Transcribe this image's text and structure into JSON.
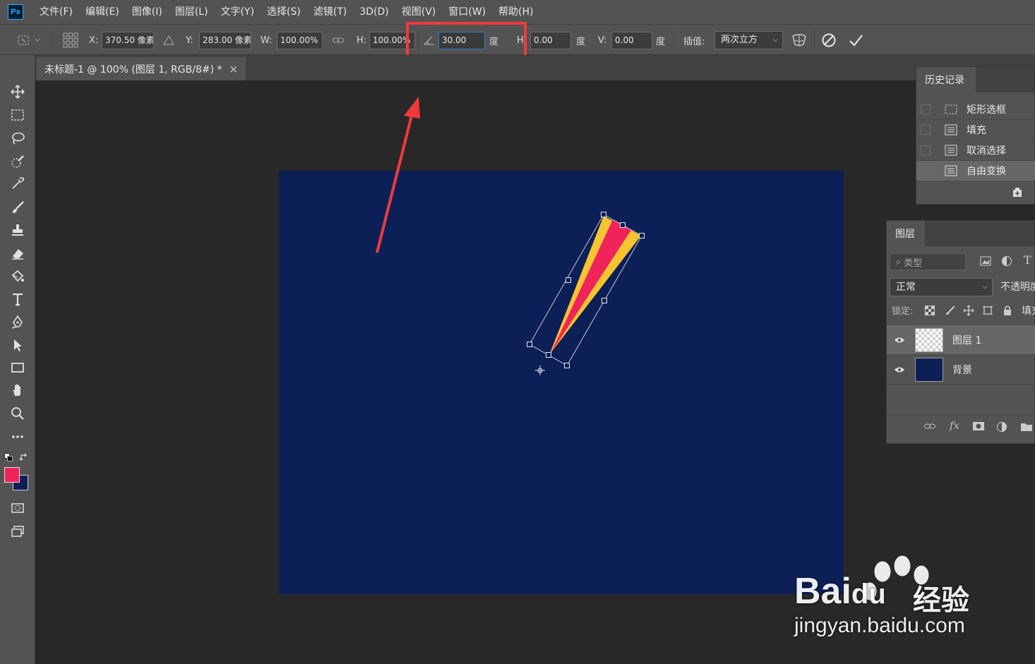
{
  "app": {
    "logo": "Ps",
    "menus": [
      "文件(F)",
      "编辑(E)",
      "图像(I)",
      "图层(L)",
      "文字(Y)",
      "选择(S)",
      "滤镜(T)",
      "3D(D)",
      "视图(V)",
      "窗口(W)",
      "帮助(H)"
    ]
  },
  "options": {
    "x_label": "X:",
    "x_value": "370.50 像素",
    "y_label": "Y:",
    "y_value": "283.00 像素",
    "w_label": "W:",
    "w_value": "100.00%",
    "h_label": "H:",
    "h_value": "100.00%",
    "angle_value": "30.00",
    "angle_unit": "度",
    "hskew_label": "H",
    "hskew_value": "0.00",
    "hskew_unit": "度",
    "vskew_label": "V:",
    "vskew_value": "0.00",
    "vskew_unit": "度",
    "interp_label": "插值:",
    "interp_value": "两次立方"
  },
  "document": {
    "tab_title": "未标题-1 @ 100% (图层 1, RGB/8#) *",
    "close": "×",
    "canvas_color": "#0c1f57"
  },
  "colors": {
    "foreground": "#f0245a",
    "background": "#0c1f57",
    "accent_red": "#f03a3a",
    "shape_yellow": "#f5c430",
    "shape_pink": "#f0245a"
  },
  "history": {
    "title": "历史记录",
    "items": [
      {
        "label": "矩形选框",
        "icon": "marquee-icon"
      },
      {
        "label": "填充",
        "icon": "history-doc-icon"
      },
      {
        "label": "取消选择",
        "icon": "history-doc-icon"
      },
      {
        "label": "自由变换",
        "icon": "history-doc-icon"
      }
    ],
    "selected_index": 3
  },
  "layers": {
    "title": "图层",
    "filter_placeholder": "类型",
    "blend_mode": "正常",
    "opacity_label": "不透明度",
    "lock_label": "锁定:",
    "fill_label": "填充",
    "items": [
      {
        "name": "图层 1",
        "visible": true,
        "selected": true
      },
      {
        "name": "背景",
        "visible": true,
        "selected": false
      }
    ]
  },
  "watermark": {
    "brand": "Bai",
    "brand_tail": "du",
    "cn": "经验",
    "url": "jingyan.baidu.com"
  }
}
